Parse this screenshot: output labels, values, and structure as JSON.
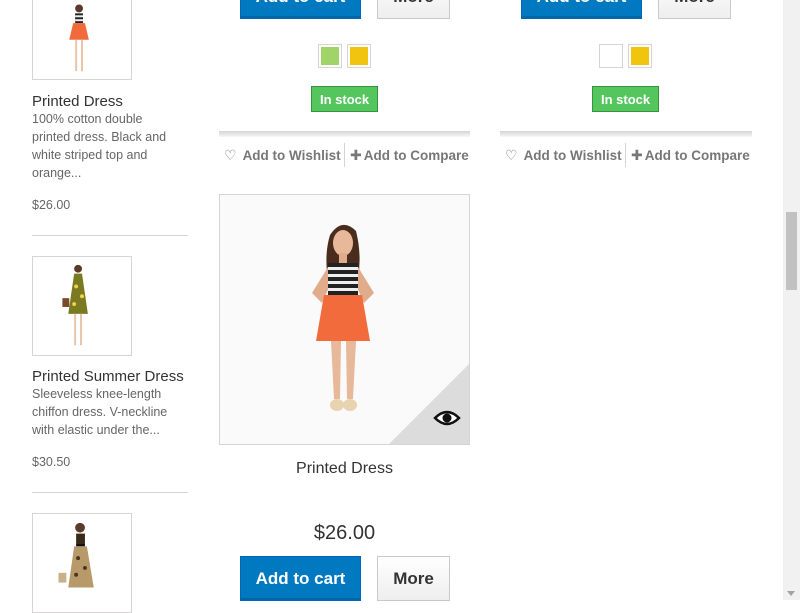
{
  "sidebar": {
    "items": [
      {
        "title": "Printed Dress",
        "description": "100% cotton double printed dress. Black and white striped top and orange...",
        "price": "$26.00",
        "thumb_icon": "dress-orange-icon"
      },
      {
        "title": "Printed Summer Dress",
        "description": "Sleeveless knee-length chiffon dress. V-neckline with elastic under the...",
        "price": "$30.50",
        "thumb_icon": "dress-yellow-icon"
      },
      {
        "title": "",
        "description": "",
        "price": "",
        "thumb_icon": "dress-leopard-icon"
      }
    ]
  },
  "grid": {
    "top_row": [
      {
        "add_to_cart": "Add to cart",
        "more": "More",
        "stock": "In stock",
        "swatches": [
          "#a0d468",
          "#f1c40f"
        ],
        "wishlist": "Add to Wishlist",
        "compare": "Add to Compare"
      },
      {
        "add_to_cart": "Add to cart",
        "more": "More",
        "stock": "In stock",
        "swatches": [
          "#ffffff",
          "#f1c40f"
        ],
        "wishlist": "Add to Wishlist",
        "compare": "Add to Compare"
      }
    ],
    "card": {
      "name": "Printed Dress",
      "price": "$26.00",
      "add_to_cart": "Add to cart",
      "more": "More",
      "quick_view_icon": "eye-icon"
    }
  },
  "colors": {
    "primary": "#0079c1",
    "stock_green": "#55c65e"
  }
}
